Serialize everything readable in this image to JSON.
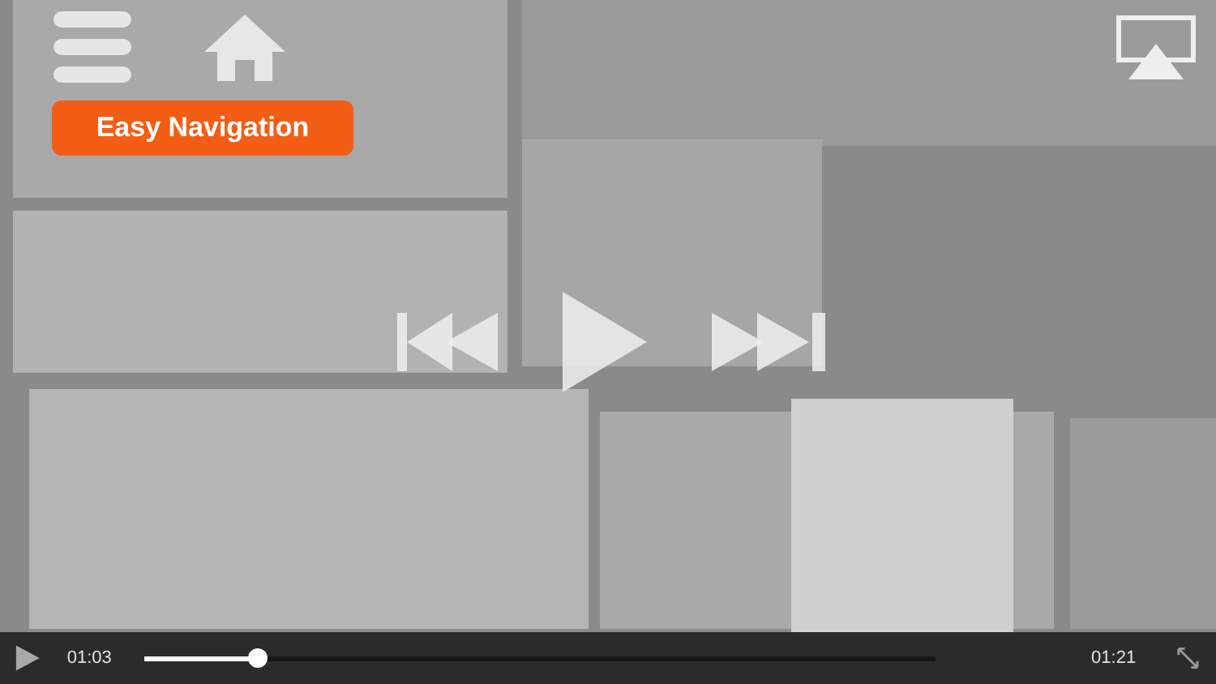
{
  "callout": {
    "text": "Easy Navigation"
  },
  "player": {
    "elapsed": "01:03",
    "remaining": "01:21",
    "progress": {
      "level": 0.143
    }
  }
}
